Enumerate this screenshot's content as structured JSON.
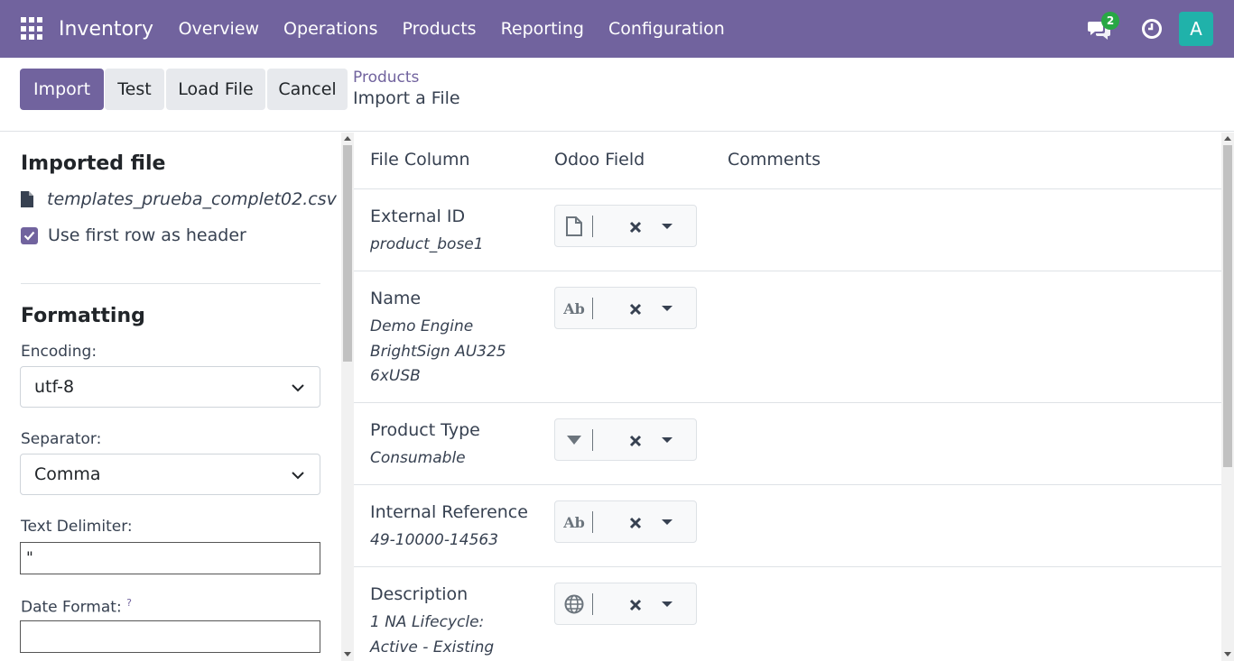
{
  "navbar": {
    "brand": "Inventory",
    "menu": [
      "Overview",
      "Operations",
      "Products",
      "Reporting",
      "Configuration"
    ],
    "messages_count": "2",
    "avatar_letter": "A"
  },
  "control": {
    "import_label": "Import",
    "test_label": "Test",
    "load_file_label": "Load File",
    "cancel_label": "Cancel",
    "breadcrumb_parent": "Products",
    "breadcrumb_current": "Import a File"
  },
  "sidebar": {
    "imported_file_heading": "Imported file",
    "file_name": "templates_prueba_complet02.csv",
    "use_header_label": "Use first row as header",
    "formatting_heading": "Formatting",
    "encoding_label": "Encoding:",
    "encoding_value": "utf-8",
    "separator_label": "Separator:",
    "separator_value": "Comma",
    "text_delimiter_label": "Text Delimiter:",
    "text_delimiter_value": "\"",
    "date_format_label": "Date Format:",
    "date_format_help": "?",
    "date_format_value": ""
  },
  "table": {
    "headers": [
      "File Column",
      "Odoo Field",
      "Comments"
    ],
    "rows": [
      {
        "column": "External ID",
        "sample": [
          "product_bose1"
        ],
        "icon": "file-icon"
      },
      {
        "column": "Name",
        "sample": [
          "Demo Engine",
          "BrightSign AU325",
          "6xUSB"
        ],
        "icon": "text-ab-icon",
        "icon_text": "Ab"
      },
      {
        "column": "Product Type",
        "sample": [
          "Consumable"
        ],
        "icon": "selection-caret-icon"
      },
      {
        "column": "Internal Reference",
        "sample": [
          "49-10000-14563"
        ],
        "icon": "text-ab-icon",
        "icon_text": "Ab"
      },
      {
        "column": "Description",
        "sample": [
          "1 NA Lifecycle:",
          "Active - Existing"
        ],
        "icon": "globe-icon"
      }
    ]
  },
  "colors": {
    "brand": "#71639e",
    "avatar": "#20b2aa",
    "badge": "#28a745"
  }
}
